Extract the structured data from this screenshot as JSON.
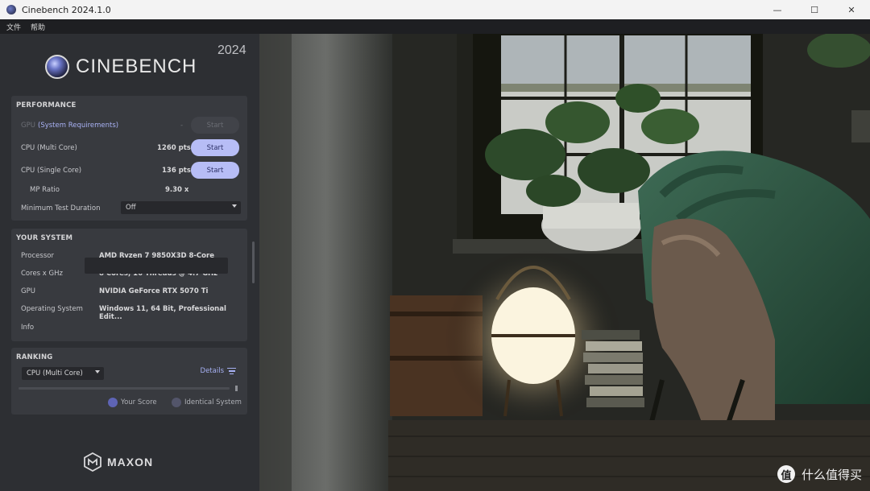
{
  "window": {
    "title": "Cinebench 2024.1.0",
    "controls": [
      "—",
      "☐",
      "✕"
    ]
  },
  "menu": [
    "文件",
    "帮助"
  ],
  "brand": {
    "logo_text": "CINEBENCH",
    "year": "2024",
    "footer_logo": "MAXON"
  },
  "performance": {
    "header": "PERFORMANCE",
    "gpu": {
      "label": "GPU",
      "requirements_link": "(System Requirements)",
      "score": "-",
      "button": "Start"
    },
    "cpu_multi": {
      "label": "CPU (Multi Core)",
      "score": "1260 pts",
      "button": "Start"
    },
    "cpu_single": {
      "label": "CPU (Single Core)",
      "score": "136 pts",
      "button": "Start"
    },
    "mp_ratio": {
      "label": "MP Ratio",
      "value": "9.30 x"
    },
    "min_duration": {
      "label": "Minimum Test Duration",
      "value": "Off"
    }
  },
  "system": {
    "header": "YOUR SYSTEM",
    "rows": [
      {
        "label": "Processor",
        "value": "AMD Ryzen 7 9850X3D 8-Core Proces..."
      },
      {
        "label": "Cores x GHz",
        "value": "8 Cores, 16 Threads @ 4.7 GHz"
      },
      {
        "label": "GPU",
        "value": "NVIDIA GeForce RTX 5070 Ti"
      },
      {
        "label": "Operating System",
        "value": "Windows 11, 64 Bit, Professional Edit..."
      },
      {
        "label": "Info",
        "value": ""
      }
    ]
  },
  "ranking": {
    "header": "RANKING",
    "selector": "CPU (Multi Core)",
    "details": "Details",
    "legend": [
      {
        "label": "Your Score",
        "color": "#5e64b5"
      },
      {
        "label": "Identical System",
        "color": "#53556a"
      }
    ]
  },
  "watermark": {
    "icon_text": "值",
    "text": "什么值得买"
  },
  "colors": {
    "accent": "#b7bdf6",
    "panel": "#2d2f33",
    "card": "#383a3f"
  }
}
